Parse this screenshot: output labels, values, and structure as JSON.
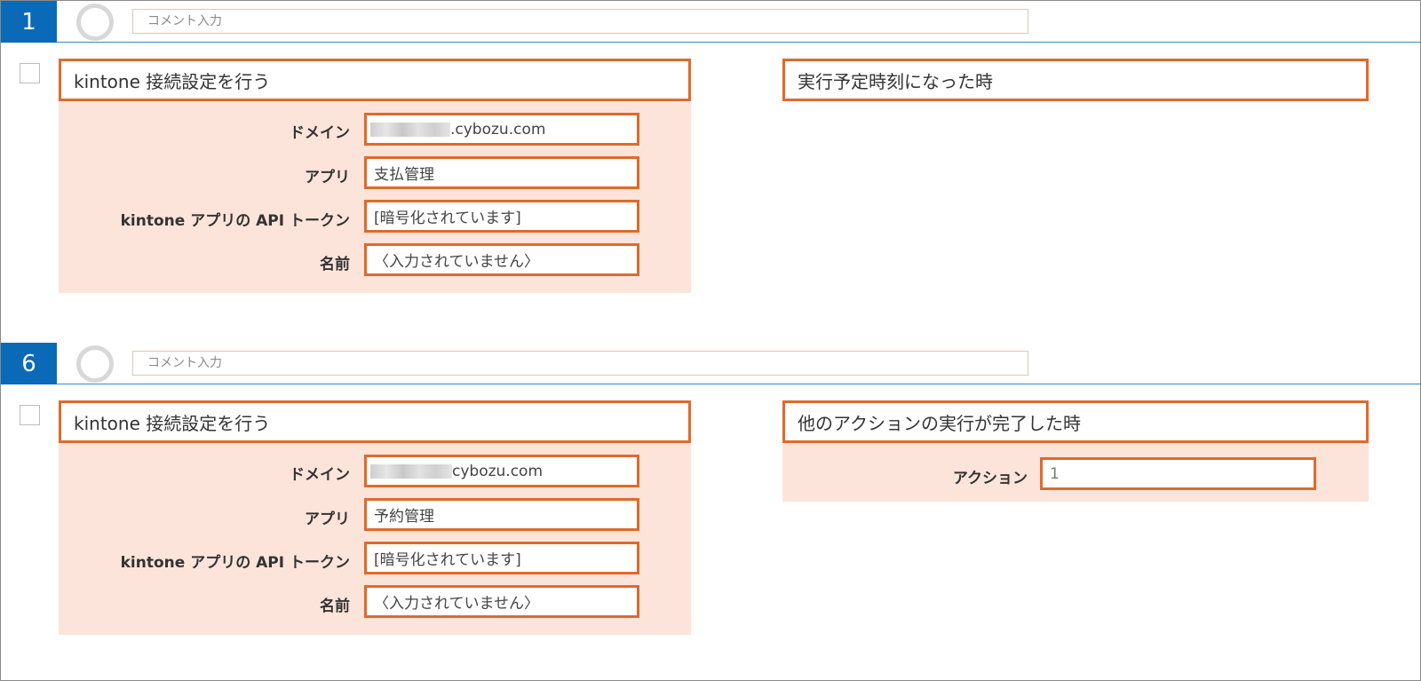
{
  "comment_placeholder": "コメント入力",
  "steps": [
    {
      "number": "1",
      "action": {
        "title": "kintone 接続設定を行う",
        "fields": [
          {
            "label": "ドメイン",
            "value": ".cybozu.com",
            "redacted": true
          },
          {
            "label": "アプリ",
            "value": "支払管理"
          },
          {
            "label": "kintone アプリの API トークン",
            "value": "[暗号化されています]"
          },
          {
            "label": "名前",
            "value": "〈入力されていません〉"
          }
        ]
      },
      "trigger": {
        "title": "実行予定時刻になった時"
      }
    },
    {
      "number": "6",
      "action": {
        "title": "kintone 接続設定を行う",
        "fields": [
          {
            "label": "ドメイン",
            "value": "cybozu.com",
            "redacted": true
          },
          {
            "label": "アプリ",
            "value": "予約管理"
          },
          {
            "label": "kintone アプリの API トークン",
            "value": "[暗号化されています]"
          },
          {
            "label": "名前",
            "value": "〈入力されていません〉"
          }
        ]
      },
      "trigger": {
        "title": "他のアクションの実行が完了した時",
        "fields": [
          {
            "label": "アクション",
            "value": "1"
          }
        ]
      }
    }
  ],
  "colors": {
    "accent_orange": "#e06a2a",
    "panel_bg": "#fde4da",
    "step_badge_blue": "#0a6ab8",
    "header_line_blue": "#3b88c8"
  }
}
